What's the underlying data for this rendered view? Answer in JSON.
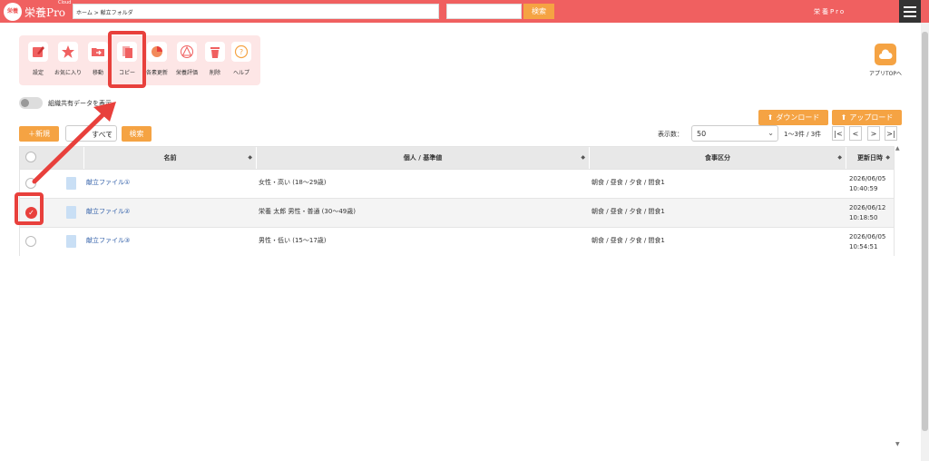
{
  "header": {
    "logo_badge": "栄養",
    "logo_text": "栄養Pro",
    "logo_superscript": "Cloud",
    "breadcrumb": "ホーム > 献立フォルダ",
    "search_placeholder": "",
    "search_button": "検索",
    "user_name": "栄養Pro",
    "accent_color": "#f06060"
  },
  "toolbar": {
    "items": [
      {
        "label": "設定",
        "icon": "pencil-icon"
      },
      {
        "label": "お気に入り",
        "icon": "star-icon"
      },
      {
        "label": "移動",
        "icon": "folder-move-icon"
      },
      {
        "label": "コピー",
        "icon": "copy-icon"
      },
      {
        "label": "各素更新",
        "icon": "refresh-icon"
      },
      {
        "label": "栄養評価",
        "icon": "evaluation-icon"
      },
      {
        "label": "削除",
        "icon": "trash-icon"
      },
      {
        "label": "ヘルプ",
        "icon": "help-icon"
      }
    ],
    "highlighted": "コピー"
  },
  "app_top": {
    "label": "アプリTOPへ",
    "icon": "cloud-icon"
  },
  "shared_toggle": {
    "label": "組織共有データを表示",
    "on": false
  },
  "actions": {
    "new_button": "＋新規",
    "filter_value": "すべて",
    "search_button": "検索",
    "download_button": "ダウンロード",
    "upload_button": "アップロード"
  },
  "pagination": {
    "perpage_label": "表示数：",
    "perpage_value": "50",
    "count": "1〜3件 / 3件",
    "first": "|<",
    "prev": "<",
    "next": ">",
    "last": ">|"
  },
  "table": {
    "columns": [
      "名前",
      "個人 / 基準値",
      "食事区分",
      "更新日時"
    ],
    "rows": [
      {
        "name": "献立ファイル①",
        "target": "女性・高い (18〜29歳)",
        "meals": "朝食 / 昼食 / 夕食 / 間食1",
        "date": "2026/06/05",
        "time": "10:40:59",
        "selected": false
      },
      {
        "name": "献立ファイル②",
        "target": "栄養 太郎 男性・普通 (30〜49歳)",
        "meals": "朝食 / 昼食 / 夕食 / 間食1",
        "date": "2026/06/12",
        "time": "10:18:50",
        "selected": true
      },
      {
        "name": "献立ファイル③",
        "target": "男性・低い (15〜17歳)",
        "meals": "朝食 / 昼食 / 夕食 / 間食1",
        "date": "2026/06/05",
        "time": "10:54:51",
        "selected": false
      }
    ]
  }
}
